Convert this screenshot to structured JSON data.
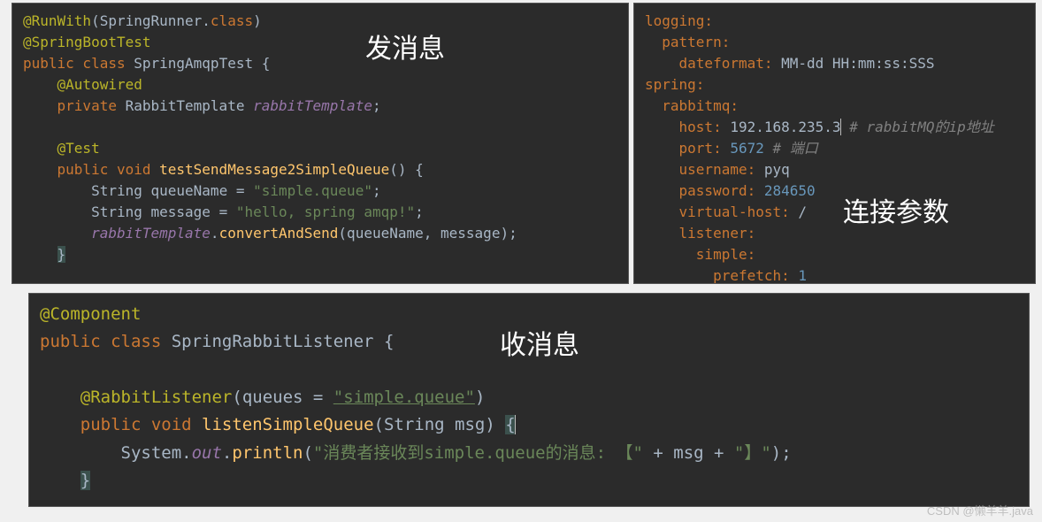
{
  "labels": {
    "send": "发消息",
    "params": "连接参数",
    "receive": "收消息"
  },
  "java1": {
    "l1_anno": "@RunWith",
    "l1_par1": "(SpringRunner.",
    "l1_cls": "class",
    "l1_par2": ")",
    "l2": "@SpringBootTest",
    "l3_kw1": "public",
    "l3_kw2": " class ",
    "l3_name": "SpringAmqpTest ",
    "l3_brace": "{",
    "l4_pad": "    ",
    "l4": "@Autowired",
    "l5_pad": "    ",
    "l5_kw": "private ",
    "l5_type": "RabbitTemplate ",
    "l5_var": "rabbitTemplate",
    "l5_semi": ";",
    "l6": " ",
    "l7_pad": "    ",
    "l7": "@Test",
    "l8_pad": "    ",
    "l8_kw1": "public",
    "l8_kw2": " void ",
    "l8_name": "testSendMessage2SimpleQueue",
    "l8_par": "() ",
    "l8_brace": "{",
    "l9_pad": "        ",
    "l9_type": "String ",
    "l9_var": "queueName = ",
    "l9_str": "\"simple.queue\"",
    "l9_semi": ";",
    "l10_pad": "        ",
    "l10_type": "String ",
    "l10_var": "message = ",
    "l10_str": "\"hello, spring amqp!\"",
    "l10_semi": ";",
    "l11_pad": "        ",
    "l11_obj": "rabbitTemplate",
    "l11_dot": ".",
    "l11_m": "convertAndSend",
    "l11_a": "(queueName, message);",
    "l12_pad": "    ",
    "l12": "}"
  },
  "yaml": {
    "l1": "logging:",
    "l2_pad": "  ",
    "l2": "pattern:",
    "l3_pad": "    ",
    "l3k": "dateformat: ",
    "l3v": "MM-dd HH:mm:ss:SSS",
    "l4": "spring:",
    "l5_pad": "  ",
    "l5": "rabbitmq:",
    "l6_pad": "    ",
    "l6k": "host: ",
    "l6v": "192.168.235.3",
    "l6c": " # rabbitMQ的ip地址",
    "l7_pad": "    ",
    "l7k": "port: ",
    "l7v": "5672",
    "l7c": " # 端口",
    "l8_pad": "    ",
    "l8k": "username: ",
    "l8v": "pyq",
    "l9_pad": "    ",
    "l9k": "password: ",
    "l9v": "284650",
    "l10_pad": "    ",
    "l10k": "virtual-host: ",
    "l10v": "/",
    "l11_pad": "    ",
    "l11": "listener:",
    "l12_pad": "      ",
    "l12": "simple:",
    "l13_pad": "        ",
    "l13k": "prefetch: ",
    "l13v": "1"
  },
  "java2": {
    "l1": "@Component",
    "l2_kw1": "public",
    "l2_kw2": " class ",
    "l2_name": "SpringRabbitListener ",
    "l2_brace": "{",
    "l3": " ",
    "l4_pad": "    ",
    "l4_anno": "@RabbitListener",
    "l4_p1": "(",
    "l4_attr": "queues ",
    "l4_eq": "= ",
    "l4_str": "\"simple.queue\"",
    "l4_p2": ")",
    "l5_pad": "    ",
    "l5_kw1": "public",
    "l5_kw2": " void ",
    "l5_name": "listenSimpleQueue",
    "l5_p1": "(String msg) ",
    "l5_brace": "{",
    "l6_pad": "        ",
    "l6_sys": "System.",
    "l6_out": "out",
    "l6_dot": ".",
    "l6_m": "println",
    "l6_p1": "(",
    "l6_str1": "\"消费者接收到simple.queue的消息: 【\"",
    "l6_plus1": " + msg + ",
    "l6_str2": "\"】\"",
    "l6_p2": ");",
    "l7_pad": "    ",
    "l7": "}"
  },
  "watermark": "CSDN @懒羊羊.java"
}
